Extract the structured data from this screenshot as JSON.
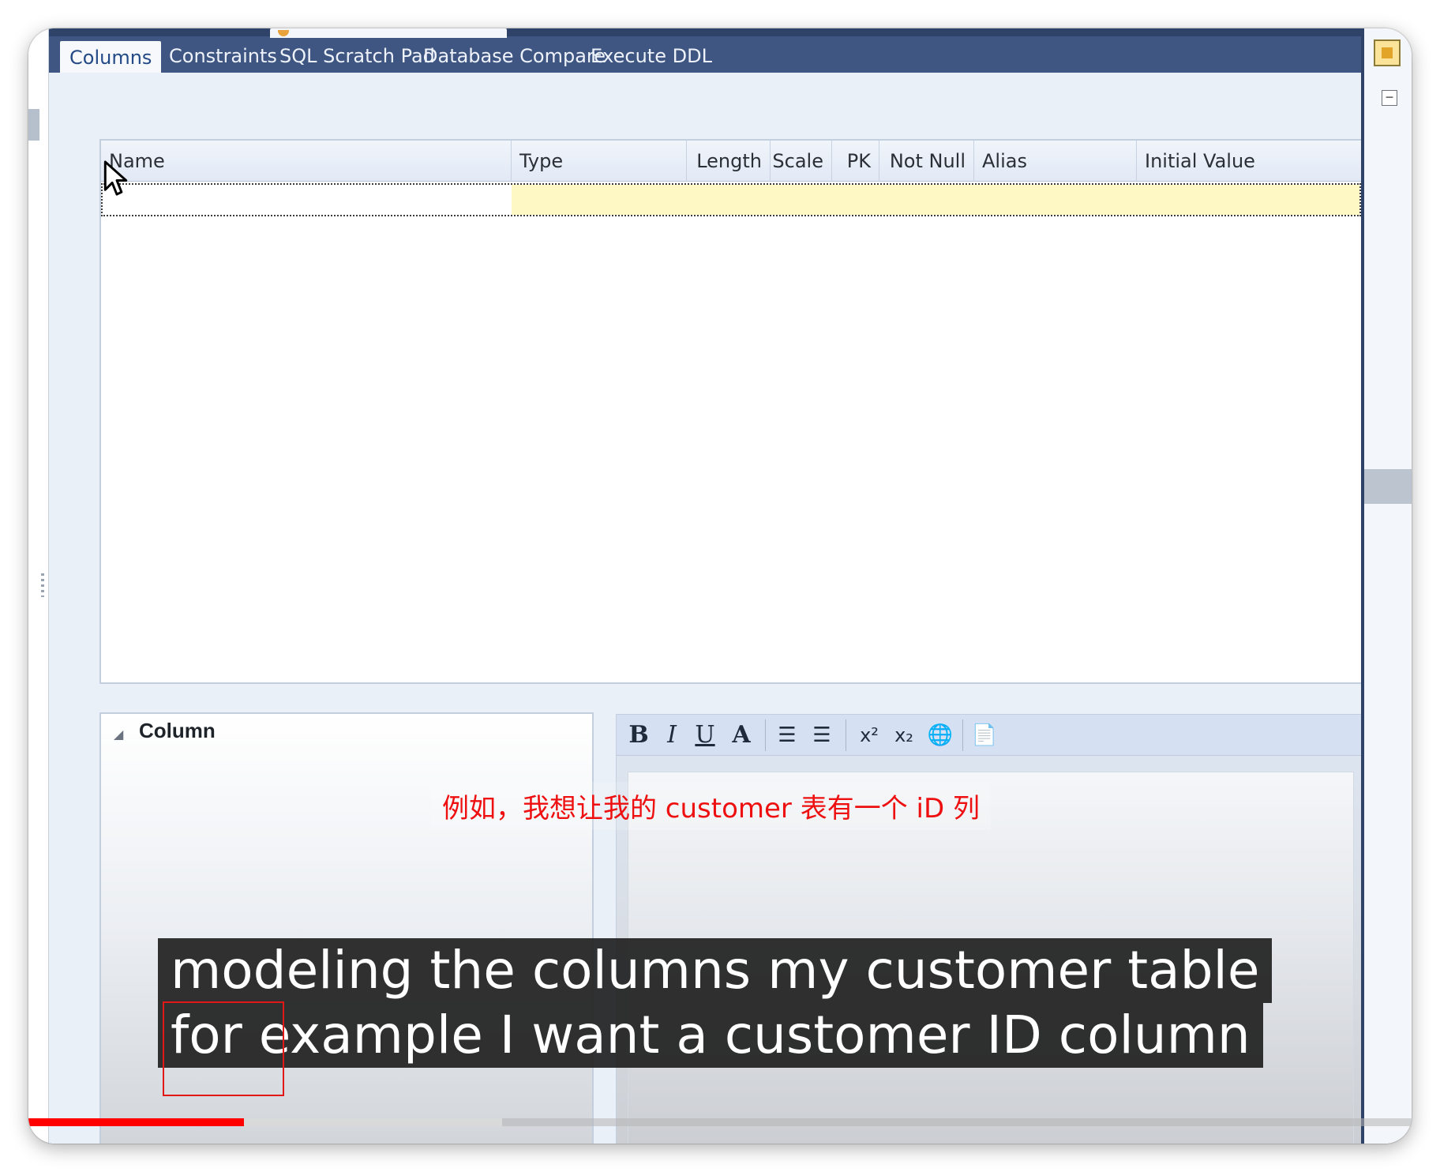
{
  "tabs": {
    "items": [
      {
        "label": "Columns",
        "active": true
      },
      {
        "label": "Constraints",
        "active": false
      },
      {
        "label": "SQL Scratch Pad",
        "active": false
      },
      {
        "label": "Database Compare",
        "active": false
      },
      {
        "label": "Execute DDL",
        "active": false
      }
    ]
  },
  "grid": {
    "columns": [
      "Name",
      "Type",
      "Length",
      "Scale",
      "PK",
      "Not Null",
      "Alias",
      "Initial Value"
    ],
    "rows": []
  },
  "properties": {
    "section_title": "Column",
    "expander_icon": "triangle-collapse-icon"
  },
  "editor": {
    "toolbar": [
      {
        "name": "bold-button",
        "glyph": "B"
      },
      {
        "name": "italic-button",
        "glyph": "I"
      },
      {
        "name": "underline-button",
        "glyph": "U"
      },
      {
        "name": "font-color-button",
        "glyph": "A"
      },
      {
        "name": "bullet-list-button",
        "glyph": "☰"
      },
      {
        "name": "numbered-list-button",
        "glyph": "☰"
      },
      {
        "name": "superscript-button",
        "glyph": "x²"
      },
      {
        "name": "subscript-button",
        "glyph": "x₂"
      },
      {
        "name": "hyperlink-button",
        "glyph": "🌐"
      },
      {
        "name": "document-button",
        "glyph": "📄"
      }
    ]
  },
  "subtitles": {
    "chinese": "例如，我想让我的 customer 表有一个 iD 列",
    "english_line1": "modeling the columns my customer table",
    "english_line2": "for example I want a customer ID column"
  },
  "colors": {
    "tab_bar": "#3f5682",
    "active_tab_text": "#234a86",
    "new_row_highlight": "#fef9c4",
    "chinese_subtitle": "#ee1010",
    "progress_played": "#ff0000"
  },
  "video": {
    "progress_fraction": 0.156
  }
}
